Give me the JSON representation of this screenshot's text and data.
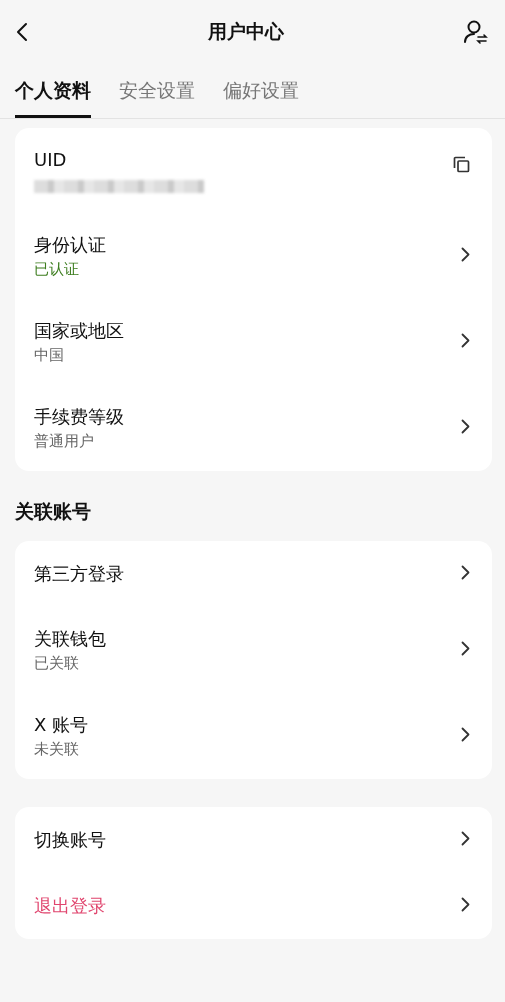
{
  "header": {
    "title": "用户中心"
  },
  "tabs": [
    {
      "label": "个人资料",
      "selected": true
    },
    {
      "label": "安全设置",
      "selected": false
    },
    {
      "label": "偏好设置",
      "selected": false
    }
  ],
  "sections": [
    {
      "rows": [
        {
          "kind": "copy",
          "title": "UID",
          "redacted": true
        },
        {
          "kind": "link",
          "title": "身份认证",
          "subtitle": "已认证",
          "color": "#3d7d1f"
        },
        {
          "kind": "link",
          "title": "国家或地区",
          "subtitle": "中国"
        },
        {
          "kind": "link",
          "title": "手续费等级",
          "subtitle": "普通用户"
        }
      ]
    },
    {
      "heading": "关联账号",
      "rows": [
        {
          "kind": "link",
          "title": "第三方登录"
        },
        {
          "kind": "link",
          "title": "关联钱包",
          "subtitle": "已关联"
        },
        {
          "kind": "link",
          "title": "X 账号",
          "subtitle": "未关联"
        }
      ]
    },
    {
      "rows": [
        {
          "kind": "link",
          "title": "切换账号"
        },
        {
          "kind": "link",
          "title": "退出登录",
          "color": "#e0456e"
        }
      ]
    }
  ]
}
